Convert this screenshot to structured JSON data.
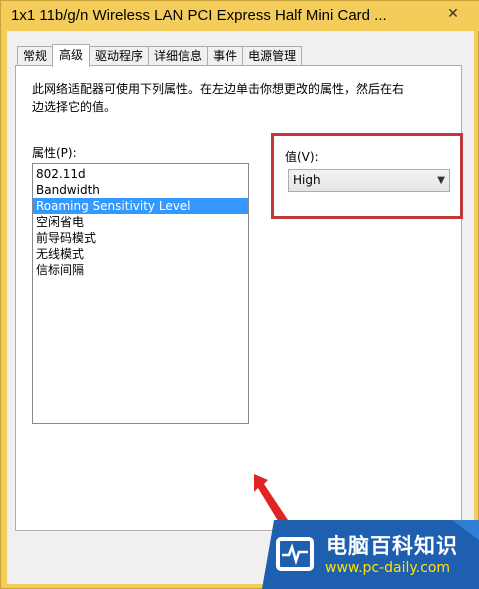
{
  "window": {
    "title": "1x1 11b/g/n Wireless LAN PCI Express Half Mini Card ...",
    "close_glyph": "✕"
  },
  "tabs": [
    {
      "label": "常规",
      "active": false
    },
    {
      "label": "高级",
      "active": true
    },
    {
      "label": "驱动程序",
      "active": false
    },
    {
      "label": "详细信息",
      "active": false
    },
    {
      "label": "事件",
      "active": false
    },
    {
      "label": "电源管理",
      "active": false
    }
  ],
  "advanced": {
    "description": "此网络适配器可使用下列属性。在左边单击你想更改的属性，然后在右边选择它的值。",
    "property_label": "属性(P):",
    "properties": [
      {
        "label": "802.11d",
        "selected": false
      },
      {
        "label": "Bandwidth",
        "selected": false
      },
      {
        "label": "Roaming Sensitivity Level",
        "selected": true
      },
      {
        "label": "空闲省电",
        "selected": false
      },
      {
        "label": "前导码模式",
        "selected": false
      },
      {
        "label": "无线模式",
        "selected": false
      },
      {
        "label": "信标间隔",
        "selected": false
      }
    ],
    "value_label": "值(V):",
    "value_selected": "High",
    "highlight_color": "#c0393b"
  },
  "watermark": {
    "title": "电脑百科知识",
    "url": "www.pc-daily.com",
    "background_color": "#1e5fb0",
    "accent_color": "#ffe400"
  },
  "colors": {
    "title_bar": "#f4cc5a",
    "selection": "#3399ff",
    "annotation_arrow": "#e02424"
  }
}
